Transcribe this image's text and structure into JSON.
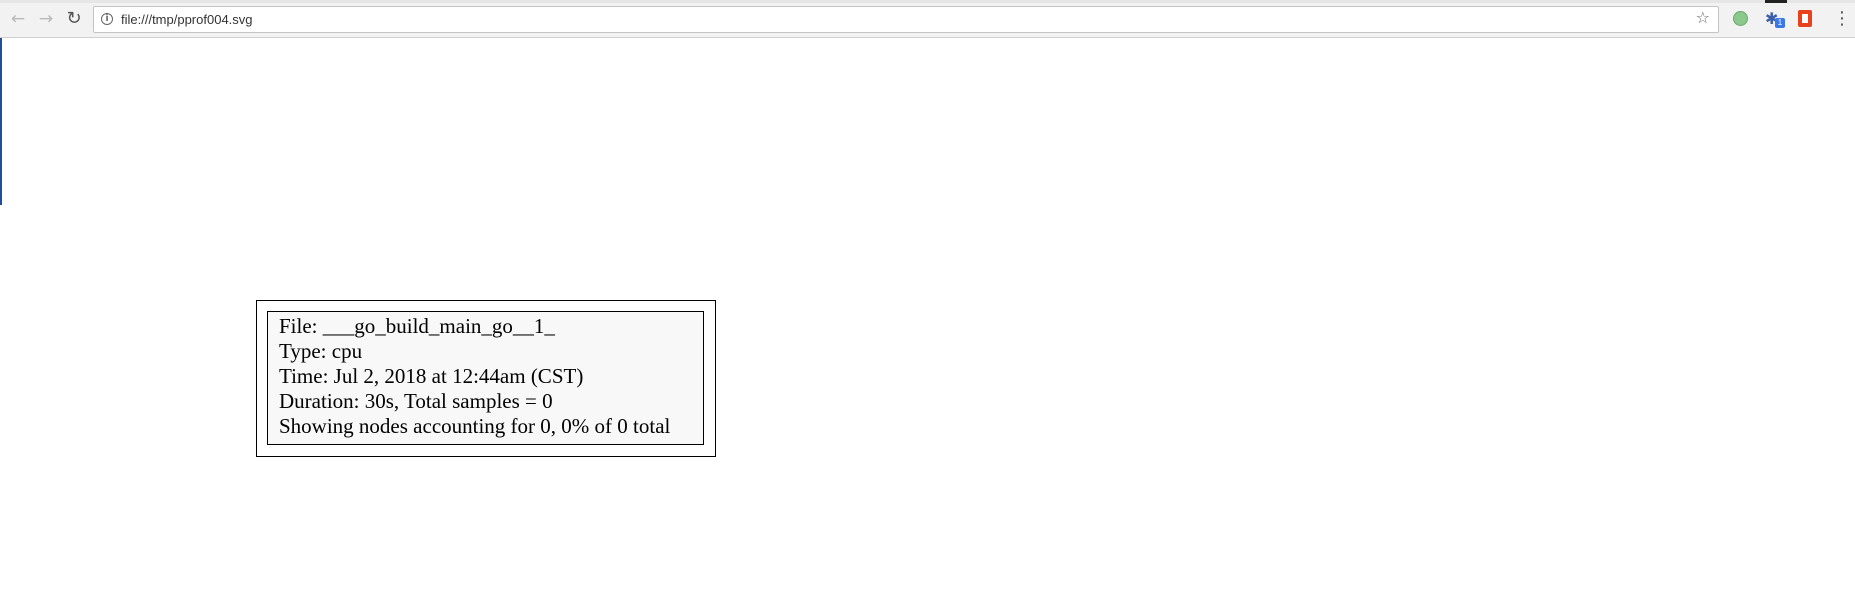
{
  "browser": {
    "url": "file:///tmp/pprof004.svg",
    "extensions": {
      "tool_badge": "1"
    },
    "icons": [
      "back-arrow-icon",
      "forward-arrow-icon",
      "reload-icon",
      "info-icon",
      "bookmark-star-icon",
      "green-circle-extension-icon",
      "tool-extension-icon",
      "office-extension-icon",
      "menu-dots-icon"
    ]
  },
  "legend": {
    "file": "File: ___go_build_main_go__1_",
    "type": "Type: cpu",
    "time": "Time: Jul 2, 2018 at 12:44am (CST)",
    "duration": "Duration: 30s, Total samples = 0",
    "showing": "Showing nodes accounting for 0, 0% of 0 total"
  }
}
